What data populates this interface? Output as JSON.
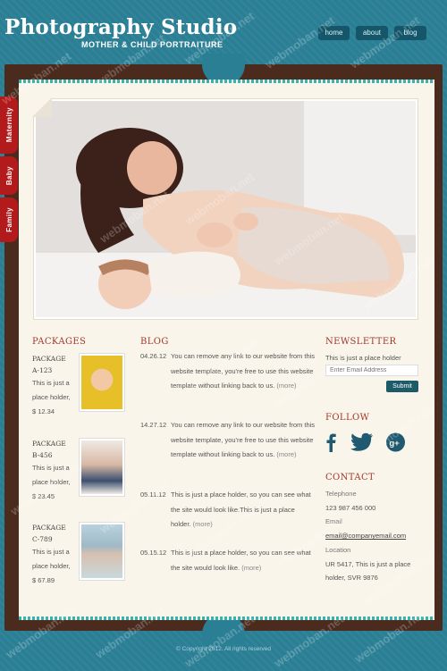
{
  "header": {
    "title": "Photography Studio",
    "subtitle": "MOTHER &  CHILD PORTRAITURE"
  },
  "nav": {
    "home": "home",
    "about": "about",
    "blog": "blog"
  },
  "side_tabs": {
    "maternity": "Maternity",
    "baby": "Baby",
    "family": "Family"
  },
  "packages": {
    "heading": "PACKAGES",
    "items": [
      {
        "name": "PACKAGE A-123",
        "text": "This is just a place holder,",
        "price": "$ 12.34"
      },
      {
        "name": "PACKAGE B-456",
        "text": "This is just a place holder,",
        "price": "$ 23.45"
      },
      {
        "name": "PACKAGE C-789",
        "text": "This is just a place holder,",
        "price": "$ 67.89"
      }
    ]
  },
  "blog": {
    "heading": "BLOG",
    "more": "(more)",
    "items": [
      {
        "date": "04.26.12",
        "text": "You can remove any link to our website from this website template, you're free to use this website template without linking back to us. "
      },
      {
        "date": "14.27.12",
        "text": "You can remove any link to our website from this website template, you're free to use this website template without linking back to us. "
      },
      {
        "date": "05.11.12",
        "text": "This is just a place holder, so you can see what the site would look like.This is just a place holder. "
      },
      {
        "date": "05.15.12",
        "text": "This is just a place holder, so you can see what the site would look like. "
      }
    ]
  },
  "newsletter": {
    "heading": "NEWSLETTER",
    "text": "This is just a place holder",
    "placeholder": "Enter Email Address",
    "submit": "Submit"
  },
  "follow": {
    "heading": "FOLLOW"
  },
  "contact": {
    "heading": "CONTACT",
    "phone_label": "Telephone",
    "phone": "123 987 456 000",
    "email_label": "Email",
    "email": "email@companyemail.com",
    "location_label": "Location",
    "location": "UR 5417, This is just a place holder, SVR 9876"
  },
  "footer": {
    "text": "© Copyright 2012. All rights reserved"
  },
  "watermark": "webmoban.net",
  "colors": {
    "background": "#2b7f95",
    "frame": "#4a2b1e",
    "paper": "#faf5ea",
    "heading": "#a4362a",
    "tab": "#b31a1c",
    "button": "#15566a"
  }
}
